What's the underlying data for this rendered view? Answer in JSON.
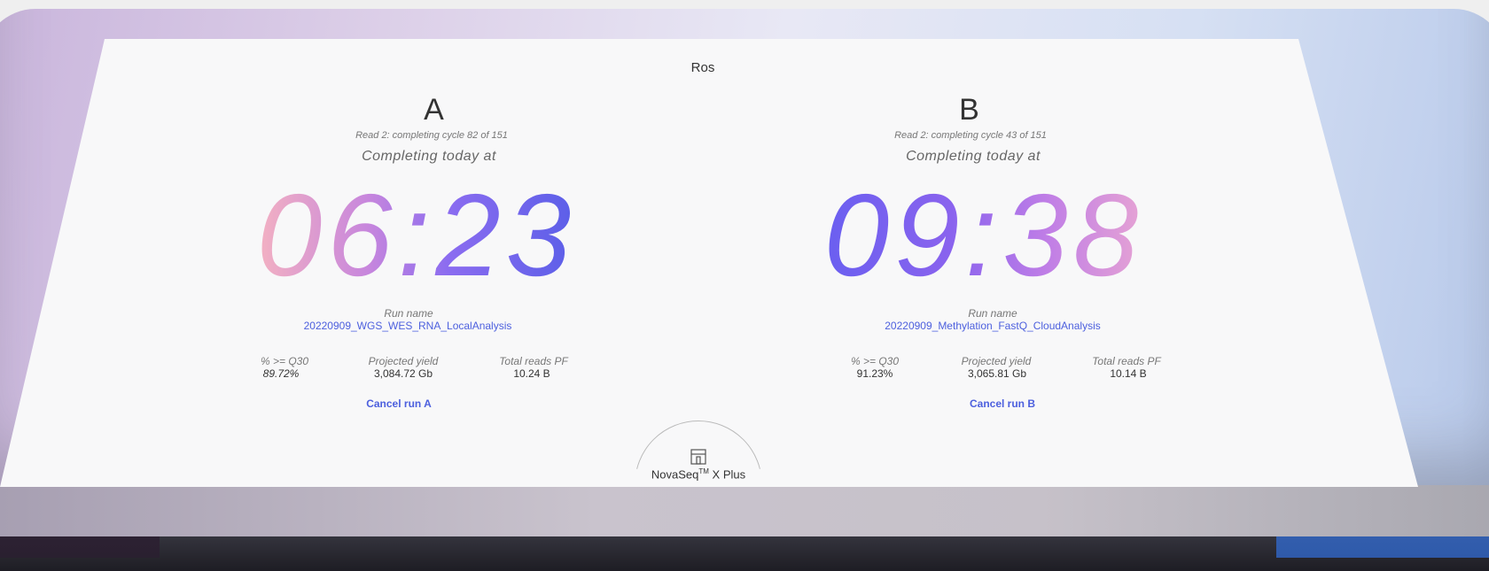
{
  "header": {
    "title": "Ros"
  },
  "runs": [
    {
      "letter": "A",
      "read_status": "Read 2: completing cycle 82 of 151",
      "completion_label": "Completing today at",
      "time_hours": "06",
      "time_minutes": "23",
      "run_name_label": "Run name",
      "run_name": "20220909_WGS_WES_RNA_LocalAnalysis",
      "metrics": {
        "q30_label": "% >= Q30",
        "q30_value": "89.72%",
        "yield_label": "Projected yield",
        "yield_value": "3,084.72 Gb",
        "reads_label": "Total reads PF",
        "reads_value": "10.24 B"
      },
      "cancel_label": "Cancel run A"
    },
    {
      "letter": "B",
      "read_status": "Read 2: completing cycle 43 of 151",
      "completion_label": "Completing today at",
      "time_hours": "09",
      "time_minutes": "38",
      "run_name_label": "Run name",
      "run_name": "20220909_Methylation_FastQ_CloudAnalysis",
      "metrics": {
        "q30_label": "% >= Q30",
        "q30_value": "91.23%",
        "yield_label": "Projected yield",
        "yield_value": "3,065.81 Gb",
        "reads_label": "Total reads PF",
        "reads_value": "10.14 B"
      },
      "cancel_label": "Cancel run B"
    }
  ],
  "instrument": {
    "name": "NovaSeq",
    "trademark": "TM",
    "suffix": " X Plus",
    "icon": "instrument-icon"
  },
  "colors": {
    "accent": "#4d60de",
    "clock_a_gradient": [
      "#f3b1c2",
      "#c786dd",
      "#8b6cf0",
      "#5b5fe8"
    ],
    "clock_b_gradient": [
      "#6a5ff0",
      "#8a63ee",
      "#c07ee6",
      "#e6a3d4"
    ]
  }
}
